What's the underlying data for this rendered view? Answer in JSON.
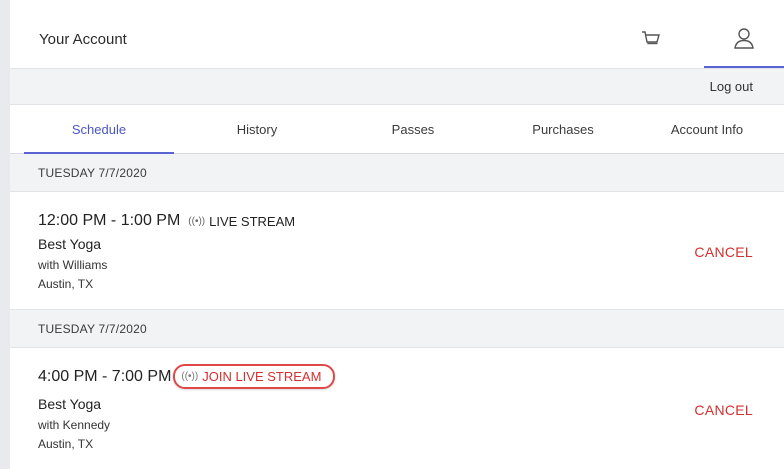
{
  "header": {
    "title": "Your Account",
    "cart_icon": "cart-icon",
    "user_icon": "user-icon"
  },
  "logout_label": "Log out",
  "tabs": [
    {
      "label": "Schedule",
      "active": true
    },
    {
      "label": "History",
      "active": false
    },
    {
      "label": "Passes",
      "active": false
    },
    {
      "label": "Purchases",
      "active": false
    },
    {
      "label": "Account Info",
      "active": false
    }
  ],
  "bookings": [
    {
      "date": "TUESDAY 7/7/2020",
      "time": "12:00 PM - 1:00 PM",
      "stream_icon": "((•))",
      "stream_label": "LIVE STREAM",
      "class_name": "Best Yoga",
      "instructor": "with Williams",
      "location": "Austin, TX",
      "action": "CANCEL"
    },
    {
      "date": "TUESDAY 7/7/2020",
      "time": "4:00 PM - 7:00 PM",
      "stream_icon": "((•))",
      "stream_label": "JOIN LIVE STREAM",
      "class_name": "Best Yoga",
      "instructor": "with Kennedy",
      "location": "Austin, TX",
      "action": "CANCEL"
    }
  ],
  "colors": {
    "accent": "#5a63d4",
    "danger": "#d32f2f",
    "panel": "#f2f3f5"
  }
}
